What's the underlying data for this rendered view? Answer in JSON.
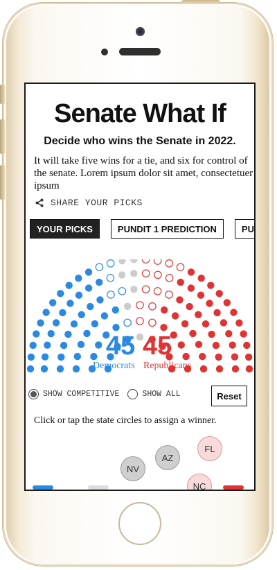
{
  "page": {
    "title": "Senate What If",
    "subtitle": "Decide who wins the Senate in 2022.",
    "intro": "It will take five wins for a tie, and six for control of the senate. Lorem ipsum dolor sit amet, consectetuer ipsum"
  },
  "share": {
    "icon": "share-icon",
    "label": "SHARE YOUR PICKS"
  },
  "tabs": [
    {
      "label": "YOUR PICKS",
      "active": true
    },
    {
      "label": "PUNDIT 1 PREDICTION",
      "active": false
    },
    {
      "label": "PUNDIT",
      "active": false
    }
  ],
  "tally": {
    "dem_count": "45",
    "dem_label": "Democrats",
    "rep_count": "45",
    "rep_label": "Republicans"
  },
  "colors": {
    "dem": "#2b8ae0",
    "rep": "#e03333",
    "tossup": "#cccccc"
  },
  "seats": {
    "rows": 6,
    "dem_solid": 45,
    "dem_leaning": 6,
    "tossup": 7,
    "rep_leaning": 14,
    "rep_solid": 45
  },
  "controls": {
    "option_competitive": "SHOW COMPETITIVE",
    "option_all": "SHOW ALL",
    "selected": "SHOW COMPETITIVE",
    "reset_label": "Reset"
  },
  "hint": "Click or tap the state circles to assign a winner.",
  "states": [
    {
      "label": "FL",
      "color": "pink"
    },
    {
      "label": "AZ",
      "color": "gray"
    },
    {
      "label": "NV",
      "color": "gray"
    },
    {
      "label": "NC",
      "color": "pink"
    }
  ]
}
